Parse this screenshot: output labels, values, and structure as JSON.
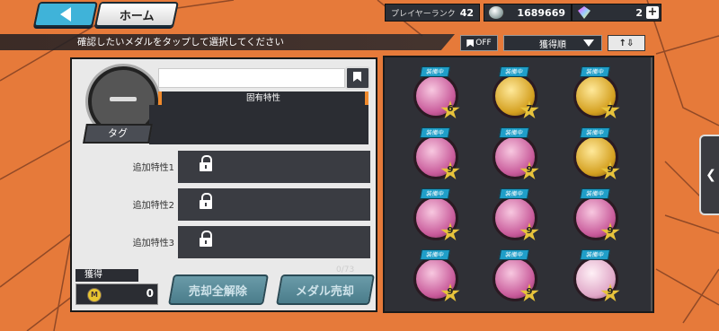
{
  "topbar": {
    "home_label": "ホーム",
    "rank_label": "プレイヤーランク",
    "rank_value": "42",
    "coins": "1689669",
    "gems": "2",
    "plus_label": "+"
  },
  "instruction": "確認したいメダルをタップして選択してください",
  "filter": {
    "bookmark_label": "OFF"
  },
  "sort": {
    "selected": "獲得順",
    "order_label": "↑⇩"
  },
  "detail": {
    "trait_header": "固有特性",
    "tag_label": "タグ",
    "sub_traits": [
      {
        "label": "追加特性1"
      },
      {
        "label": "追加特性2"
      },
      {
        "label": "追加特性3"
      }
    ]
  },
  "footer": {
    "earn_label": "獲得",
    "earn_coin_letter": "M",
    "earn_value": "0",
    "unsell_label": "売却全解除",
    "sell_label": "メダル売却",
    "sell_count": "0/73"
  },
  "medals": [
    {
      "badge": "装備中",
      "level": "6",
      "tone": "pink"
    },
    {
      "badge": "装備中",
      "level": "7",
      "tone": "gold"
    },
    {
      "badge": "装備中",
      "level": "7",
      "tone": "gold"
    },
    {
      "badge": "装備中",
      "level": "9",
      "tone": "pink"
    },
    {
      "badge": "装備中",
      "level": "9",
      "tone": "pink"
    },
    {
      "badge": "装備中",
      "level": "9",
      "tone": "gold"
    },
    {
      "badge": "装備中",
      "level": "9",
      "tone": "pink"
    },
    {
      "badge": "装備中",
      "level": "9",
      "tone": "pink"
    },
    {
      "badge": "装備中",
      "level": "9",
      "tone": "pink"
    },
    {
      "badge": "装備中",
      "level": "9",
      "tone": "pink"
    },
    {
      "badge": "装備中",
      "level": "9",
      "tone": "pink"
    },
    {
      "badge": "装備中",
      "level": "9",
      "tone": "light"
    }
  ],
  "side_tab_label": "❮"
}
